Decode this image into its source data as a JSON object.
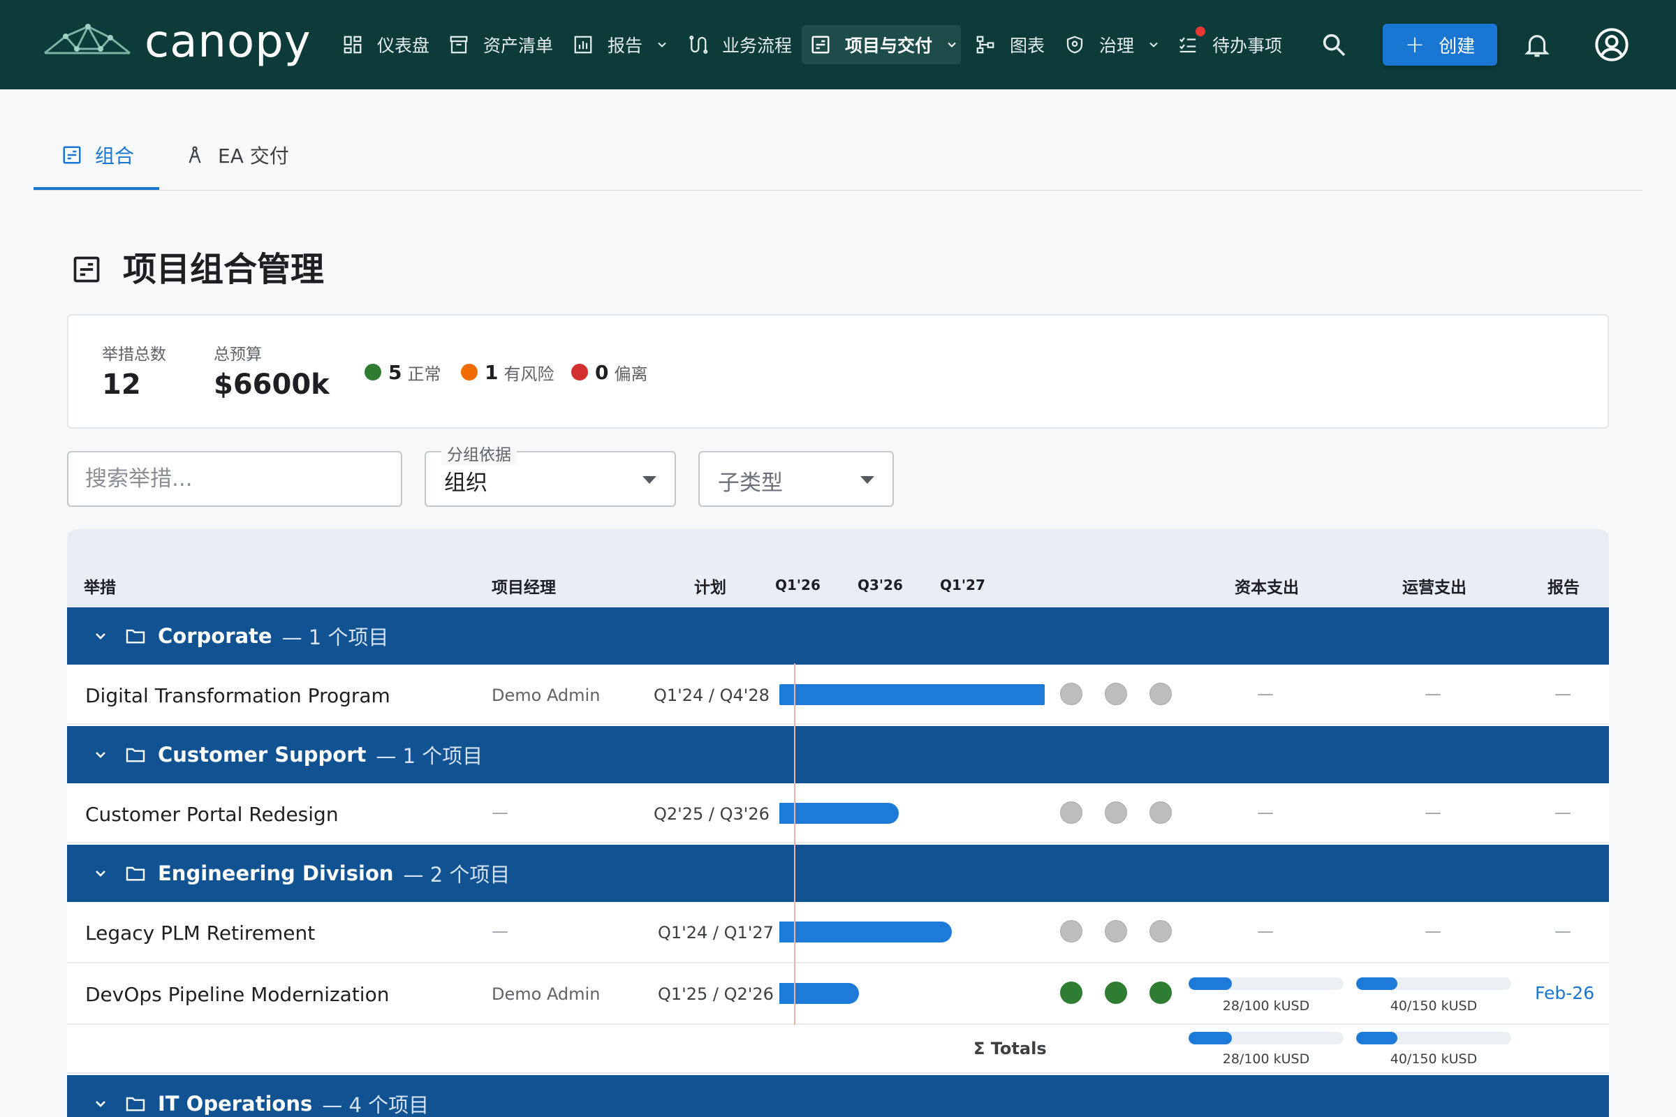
{
  "brand": {
    "name": "canopy"
  },
  "nav": {
    "items": [
      {
        "label": "仪表盘",
        "icon": "dashboard-icon"
      },
      {
        "label": "资产清单",
        "icon": "archive-icon"
      },
      {
        "label": "报告",
        "icon": "report-icon",
        "has_menu": true
      },
      {
        "label": "业务流程",
        "icon": "process-icon"
      },
      {
        "label": "项目与交付",
        "icon": "project-icon",
        "has_menu": true,
        "active": true
      },
      {
        "label": "图表",
        "icon": "diagram-icon"
      },
      {
        "label": "治理",
        "icon": "shield-icon",
        "has_menu": true
      },
      {
        "label": "待办事项",
        "icon": "todo-icon",
        "has_notification": true
      }
    ],
    "create_label": "创建"
  },
  "tabs": [
    {
      "label": "组合",
      "icon": "portfolio-icon",
      "active": true
    },
    {
      "label": "EA 交付",
      "icon": "compass-icon"
    }
  ],
  "page": {
    "title": "项目组合管理"
  },
  "summary": {
    "initiatives_label": "举措总数",
    "initiatives_value": "12",
    "budget_label": "总预算",
    "budget_value": "$6600k",
    "statuses": [
      {
        "count": "5",
        "label": "正常",
        "color": "#2e7d32"
      },
      {
        "count": "1",
        "label": "有风险",
        "color": "#ef6c00"
      },
      {
        "count": "0",
        "label": "偏离",
        "color": "#d32f2f"
      }
    ]
  },
  "filters": {
    "search_placeholder": "搜索举措...",
    "group_by_label": "分组依据",
    "group_by_value": "组织",
    "subtype_placeholder": "子类型"
  },
  "table": {
    "headers": {
      "initiative": "举措",
      "manager": "项目经理",
      "plan": "计划",
      "quarters": [
        "Q1'26",
        "Q3'26",
        "Q1'27"
      ],
      "capex": "资本支出",
      "opex": "运营支出",
      "report": "报告"
    },
    "dash": "—",
    "groups": [
      {
        "name": "Corporate",
        "count_label": "— 1 个项目",
        "rows": [
          {
            "name": "Digital Transformation Program",
            "manager": "Demo Admin",
            "plan": "Q1'24 / Q4'28",
            "bar_end_fraction": 1.0,
            "health": [
              "grey",
              "grey",
              "grey"
            ]
          }
        ]
      },
      {
        "name": "Customer Support",
        "count_label": "— 1 个项目",
        "rows": [
          {
            "name": "Customer Portal Redesign",
            "manager": "—",
            "plan": "Q2'25 / Q3'26",
            "bar_end_fraction": 0.45,
            "health": [
              "grey",
              "grey",
              "grey"
            ]
          }
        ]
      },
      {
        "name": "Engineering Division",
        "count_label": "— 2 个项目",
        "rows": [
          {
            "name": "Legacy PLM Retirement",
            "manager": "—",
            "plan": "Q1'24 / Q1'27",
            "bar_end_fraction": 0.65,
            "health": [
              "grey",
              "grey",
              "grey"
            ]
          },
          {
            "name": "DevOps Pipeline Modernization",
            "manager": "Demo Admin",
            "plan": "Q1'25 / Q2'26",
            "bar_end_fraction": 0.3,
            "health": [
              "green",
              "green",
              "green"
            ],
            "capex": {
              "spent": 28,
              "budget": 100,
              "text": "28/100 kUSD"
            },
            "opex": {
              "spent": 40,
              "budget": 150,
              "text": "40/150 kUSD"
            },
            "report": "Feb-26"
          }
        ],
        "totals": {
          "label": "Σ Totals",
          "capex": {
            "spent": 28,
            "budget": 100,
            "text": "28/100 kUSD"
          },
          "opex": {
            "spent": 40,
            "budget": 150,
            "text": "40/150 kUSD"
          }
        }
      },
      {
        "name": "IT Operations",
        "count_label": "— 4 个项目",
        "rows": []
      }
    ]
  }
}
